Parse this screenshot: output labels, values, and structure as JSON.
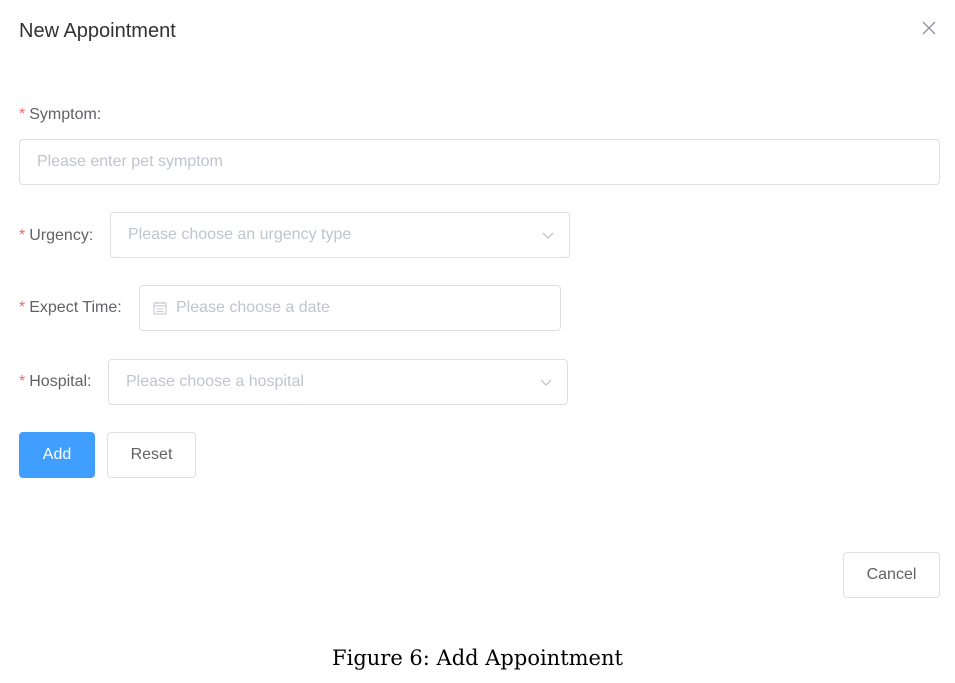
{
  "dialog": {
    "title": "New Appointment",
    "close_icon": "close-icon"
  },
  "form": {
    "required_mark": "*",
    "symptom": {
      "label": "Symptom:",
      "placeholder": "Please enter pet symptom"
    },
    "urgency": {
      "label": "Urgency:",
      "placeholder": "Please choose an urgency type",
      "icon": "chevron-down-icon"
    },
    "expect_time": {
      "label": "Expect Time:",
      "placeholder": "Please choose a date",
      "icon": "calendar-icon"
    },
    "hospital": {
      "label": "Hospital:",
      "placeholder": "Please choose a hospital",
      "icon": "chevron-down-icon"
    },
    "add_label": "Add",
    "reset_label": "Reset"
  },
  "footer": {
    "cancel_label": "Cancel"
  },
  "caption": "Figure 6: Add Appointment",
  "colors": {
    "primary": "#409eff",
    "required": "#f56c6c",
    "border": "#dcdfe6",
    "placeholder": "#c0c4cc"
  }
}
